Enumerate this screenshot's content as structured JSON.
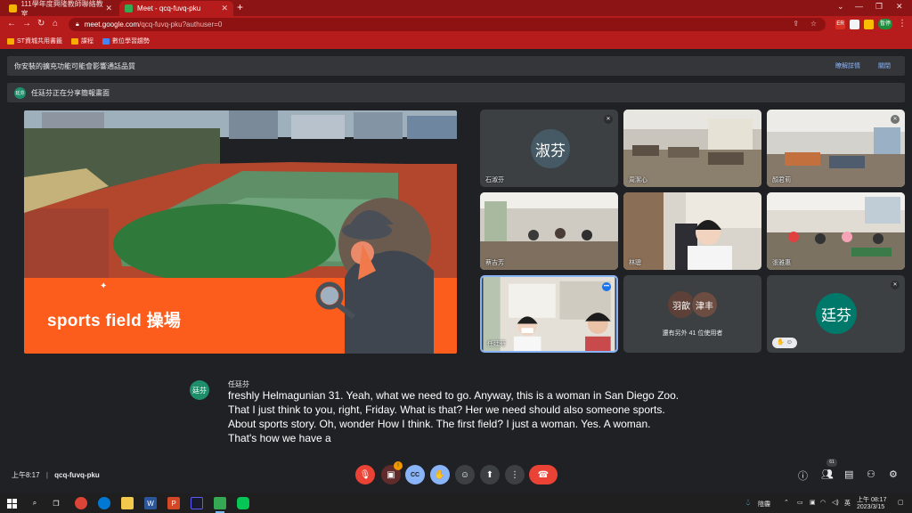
{
  "browser": {
    "tabs": [
      {
        "title": "111學年度興隆教師聯絡教室",
        "active": false
      },
      {
        "title": "Meet - qcq-fuvq-pku",
        "active": true
      }
    ],
    "new_tab_label": "+",
    "url_host": "meet.google.com",
    "url_path": "/qcq-fuvq-pku?authuser=0",
    "profile_label": "暫停",
    "ext_badge": "ER"
  },
  "bookmarks": [
    {
      "label": "ST資城共用書籤",
      "icon": "folder-icon"
    },
    {
      "label": "課程",
      "icon": "folder-icon"
    },
    {
      "label": "數位學習趨勢",
      "icon": "bookmark-icon"
    }
  ],
  "meet": {
    "banner_warning": "你安裝的擴充功能可能會影響通話品質",
    "banner_details": "瞭解詳情",
    "banner_close": "關閉",
    "presenting_initials": "廷芬",
    "presenting_text": "任廷芬正在分享簡報畫面",
    "slide_title": "sports field  操場",
    "tiles": [
      {
        "name": "石淑芬",
        "avatar": "淑芬",
        "avatar_color": "#455a64",
        "muted": true
      },
      {
        "name": "周潔心",
        "muted": false
      },
      {
        "name": "顏君莉",
        "muted": true
      },
      {
        "name": "蔡吉芳",
        "muted": false
      },
      {
        "name": "林聰",
        "muted": false
      },
      {
        "name": "張雅惠",
        "muted": false
      },
      {
        "name": "任廷芬",
        "muted": false
      },
      {
        "name": "還有另外 41 位使用者",
        "avatars": [
          "羽歆",
          "津丰"
        ]
      },
      {
        "name": "",
        "avatar": "廷芬",
        "avatar_color": "#00796b",
        "muted": true
      }
    ],
    "caption": {
      "speaker": "任廷芬",
      "speaker_initials": "廷芬",
      "lines": [
        "freshly Helmagunian 31. Yeah, what we need to go. Anyway, this is a woman in San Diego Zoo.",
        "That I just think to you, right, Friday. What is that? Her we need should also someone sports.",
        "About sports story. Oh, wonder How I think. The first field? I just a woman. Yes. A woman.",
        "That's how we have a"
      ]
    },
    "meeting_time": "上午8:17",
    "meeting_code": "qcq-fuvq-pku",
    "participant_count": "61",
    "cam_badge": "!"
  },
  "taskbar": {
    "weather": "陰霾",
    "lang": "英",
    "time": "上午 08:17",
    "date": "2023/3/15"
  },
  "colors": {
    "chrome_red": "#b71c1c",
    "meet_bg": "#202124",
    "end_call": "#ea4335",
    "slide_orange": "#fc5c1c"
  }
}
